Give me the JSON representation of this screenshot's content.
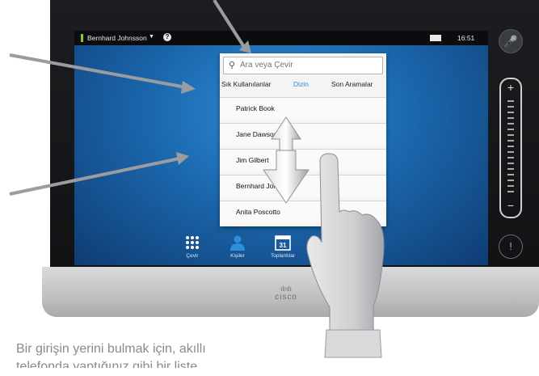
{
  "status_bar": {
    "caller_name": "Bernhard Johnsson",
    "caret": "▼",
    "help": "?",
    "time": "16:51"
  },
  "directory": {
    "search_placeholder": "Ara veya Çevir",
    "tabs": [
      "Sık Kullanılanlar",
      "Dizin",
      "Son Aramalar"
    ],
    "active_tab": "Dizin",
    "contacts": [
      "Patrick Book",
      "Jane Dawson",
      "Jim Gilbert",
      "Bernhard Johnsson",
      "Anita Poscotto"
    ]
  },
  "dock": {
    "items": [
      {
        "label": "Çevir",
        "icon": "keypad-icon"
      },
      {
        "label": "Kişiler",
        "icon": "person-icon"
      },
      {
        "label": "Toplantılar",
        "icon": "calendar-icon",
        "day": "31"
      }
    ]
  },
  "right_rail": {
    "plus": "+",
    "minus": "−",
    "info": "!"
  },
  "brand": {
    "logo_text": "cisco"
  },
  "caption": {
    "line1": "Bir girişin yerini bulmak için, akıllı",
    "line2": "telefonda yaptığınız gibi bir liste"
  },
  "colors": {
    "accent": "#2d8fd9",
    "status_green": "#7ad11e",
    "screen_blue": "#1b67ad"
  }
}
